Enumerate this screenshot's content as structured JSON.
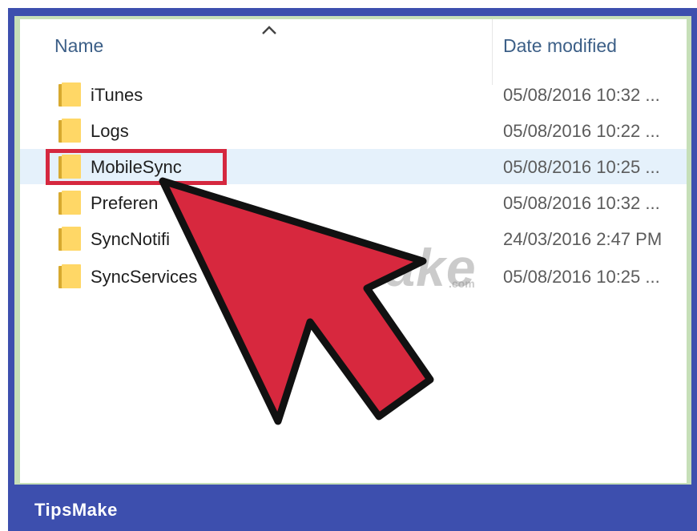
{
  "columns": {
    "name": "Name",
    "date_modified": "Date modified"
  },
  "rows": [
    {
      "name": "iTunes",
      "date": "05/08/2016 10:32 ..."
    },
    {
      "name": "Logs",
      "date": "05/08/2016 10:22 ..."
    },
    {
      "name": "MobileSync",
      "date": "05/08/2016 10:25 ..."
    },
    {
      "name": "Preferen",
      "date": "05/08/2016 10:32 ..."
    },
    {
      "name": "SyncNotifi",
      "date": "24/03/2016 2:47 PM"
    },
    {
      "name": "SyncServices",
      "date": "05/08/2016 10:25 ..."
    }
  ],
  "selected_row_index": 2,
  "watermark": {
    "text": "TipsMake",
    "suffix": ".com"
  },
  "footer": {
    "brand": "TipsMake"
  },
  "icons": {
    "sort": "sort-ascending-chevron-icon",
    "folder": "folder-icon",
    "pointer": "red-arrow-pointer-icon"
  },
  "colors": {
    "frame_blue": "#3d4fae",
    "highlight_red": "#d5283f",
    "selected_row": "#e5f1fb",
    "folder_yellow": "#ffd766",
    "header_text": "#3c5f87"
  }
}
